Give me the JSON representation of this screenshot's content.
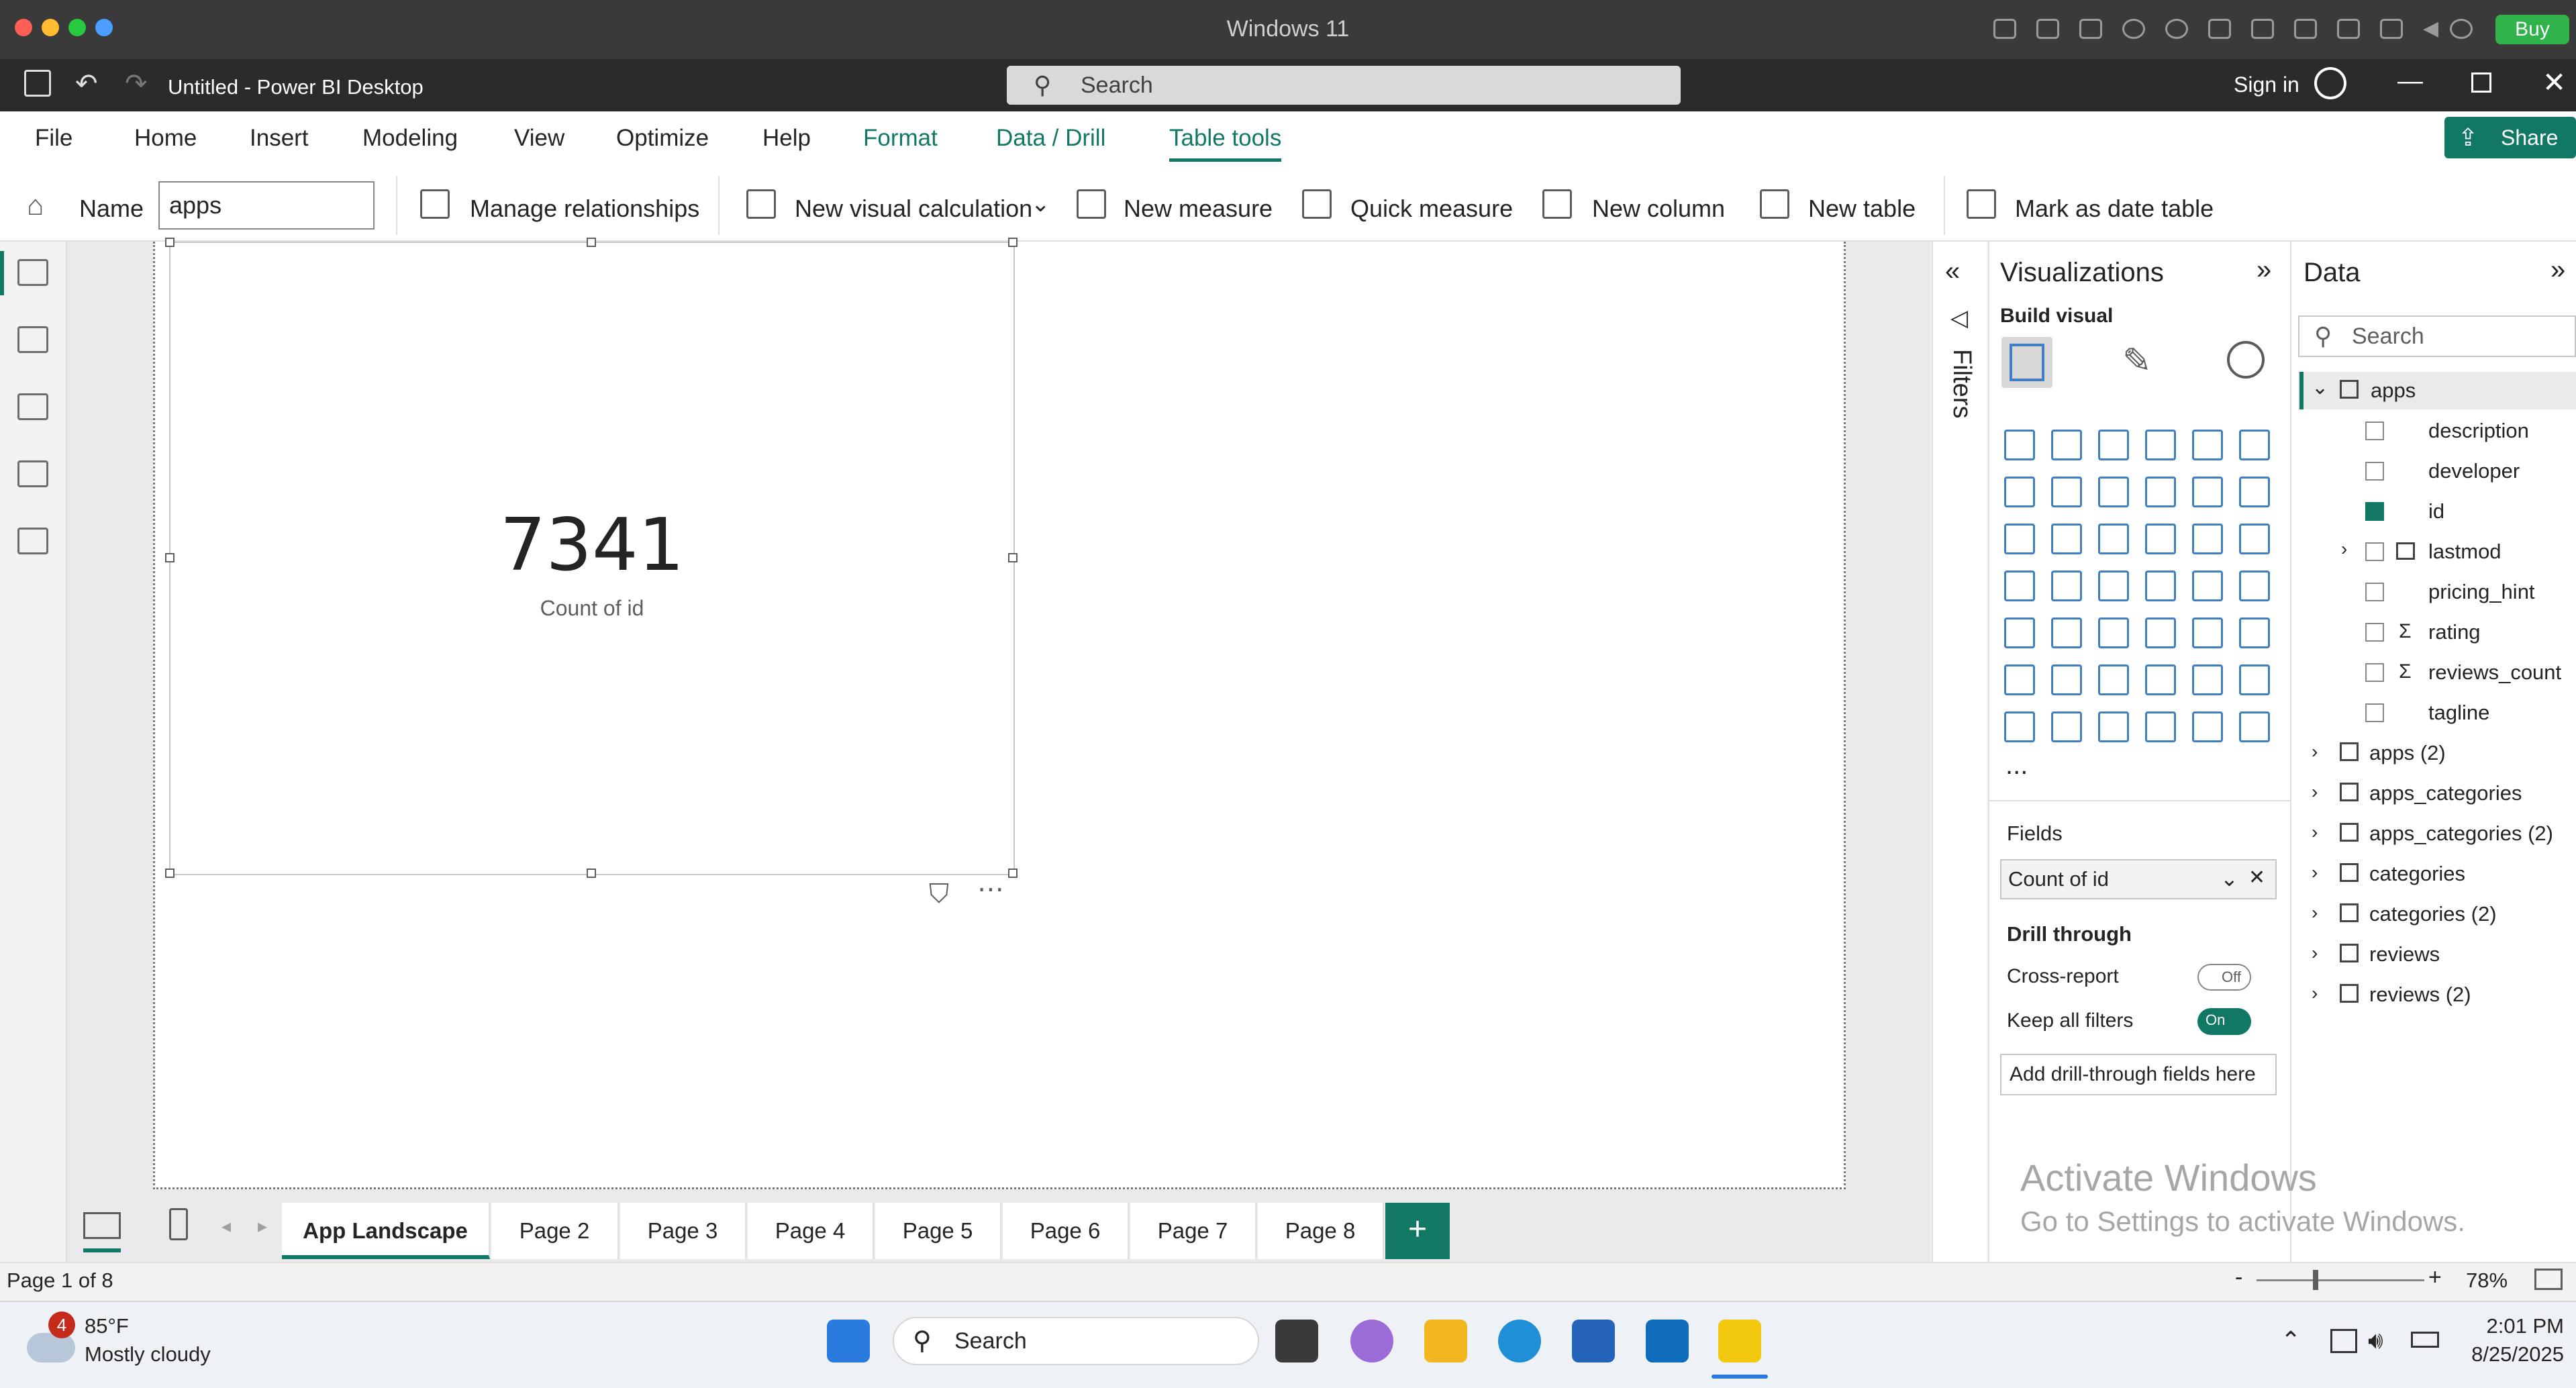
{
  "mac": {
    "title": "Windows 11",
    "buy_label": "Buy"
  },
  "app": {
    "title": "Untitled - Power BI Desktop",
    "search_placeholder": "Search",
    "sign_in": "Sign in",
    "share_label": "Share"
  },
  "menu": [
    "File",
    "Home",
    "Insert",
    "Modeling",
    "View",
    "Optimize",
    "Help",
    "Format",
    "Data / Drill",
    "Table tools"
  ],
  "ribbon": {
    "name_label": "Name",
    "name_value": "apps",
    "manage_relationships": "Manage relationships",
    "new_visual_calculation": "New visual calculation",
    "new_measure": "New measure",
    "quick_measure": "Quick measure",
    "new_column": "New column",
    "new_table": "New table",
    "mark_as_date_table": "Mark as date table"
  },
  "card": {
    "value": "7341",
    "label": "Count of id"
  },
  "filters": {
    "label": "Filters"
  },
  "visualizations": {
    "title": "Visualizations",
    "build_visual": "Build visual",
    "more": "...",
    "fields_label": "Fields",
    "field_value": "Count of id",
    "drill_through": "Drill through",
    "cross_report": "Cross-report",
    "cross_report_state": "Off",
    "keep_all_filters": "Keep all filters",
    "keep_all_filters_state": "On",
    "add_drill_through": "Add drill-through fields here"
  },
  "data_pane": {
    "title": "Data",
    "search_placeholder": "Search",
    "tables": [
      {
        "name": "apps",
        "expanded": true
      },
      {
        "name": "apps (2)"
      },
      {
        "name": "apps_categories"
      },
      {
        "name": "apps_categories (2)"
      },
      {
        "name": "categories"
      },
      {
        "name": "categories (2)"
      },
      {
        "name": "reviews"
      },
      {
        "name": "reviews (2)"
      }
    ],
    "apps_fields": [
      {
        "name": "description",
        "checked": false,
        "sigma": false
      },
      {
        "name": "developer",
        "checked": false,
        "sigma": false
      },
      {
        "name": "id",
        "checked": true,
        "sigma": false
      },
      {
        "name": "lastmod",
        "checked": false,
        "sigma": false
      },
      {
        "name": "pricing_hint",
        "checked": false,
        "sigma": false
      },
      {
        "name": "rating",
        "checked": false,
        "sigma": true
      },
      {
        "name": "reviews_count",
        "checked": false,
        "sigma": true
      },
      {
        "name": "tagline",
        "checked": false,
        "sigma": false
      }
    ]
  },
  "tabs": [
    "App Landscape",
    "Page 2",
    "Page 3",
    "Page 4",
    "Page 5",
    "Page 6",
    "Page 7",
    "Page 8"
  ],
  "status": {
    "page": "Page 1 of 8",
    "zoom": "78%"
  },
  "watermark": {
    "line1": "Activate Windows",
    "line2": "Go to Settings to activate Windows."
  },
  "taskbar": {
    "weather_badge": "4",
    "temperature": "85°F",
    "condition": "Mostly cloudy",
    "search": "Search",
    "time": "2:01 PM",
    "date": "8/25/2025"
  }
}
